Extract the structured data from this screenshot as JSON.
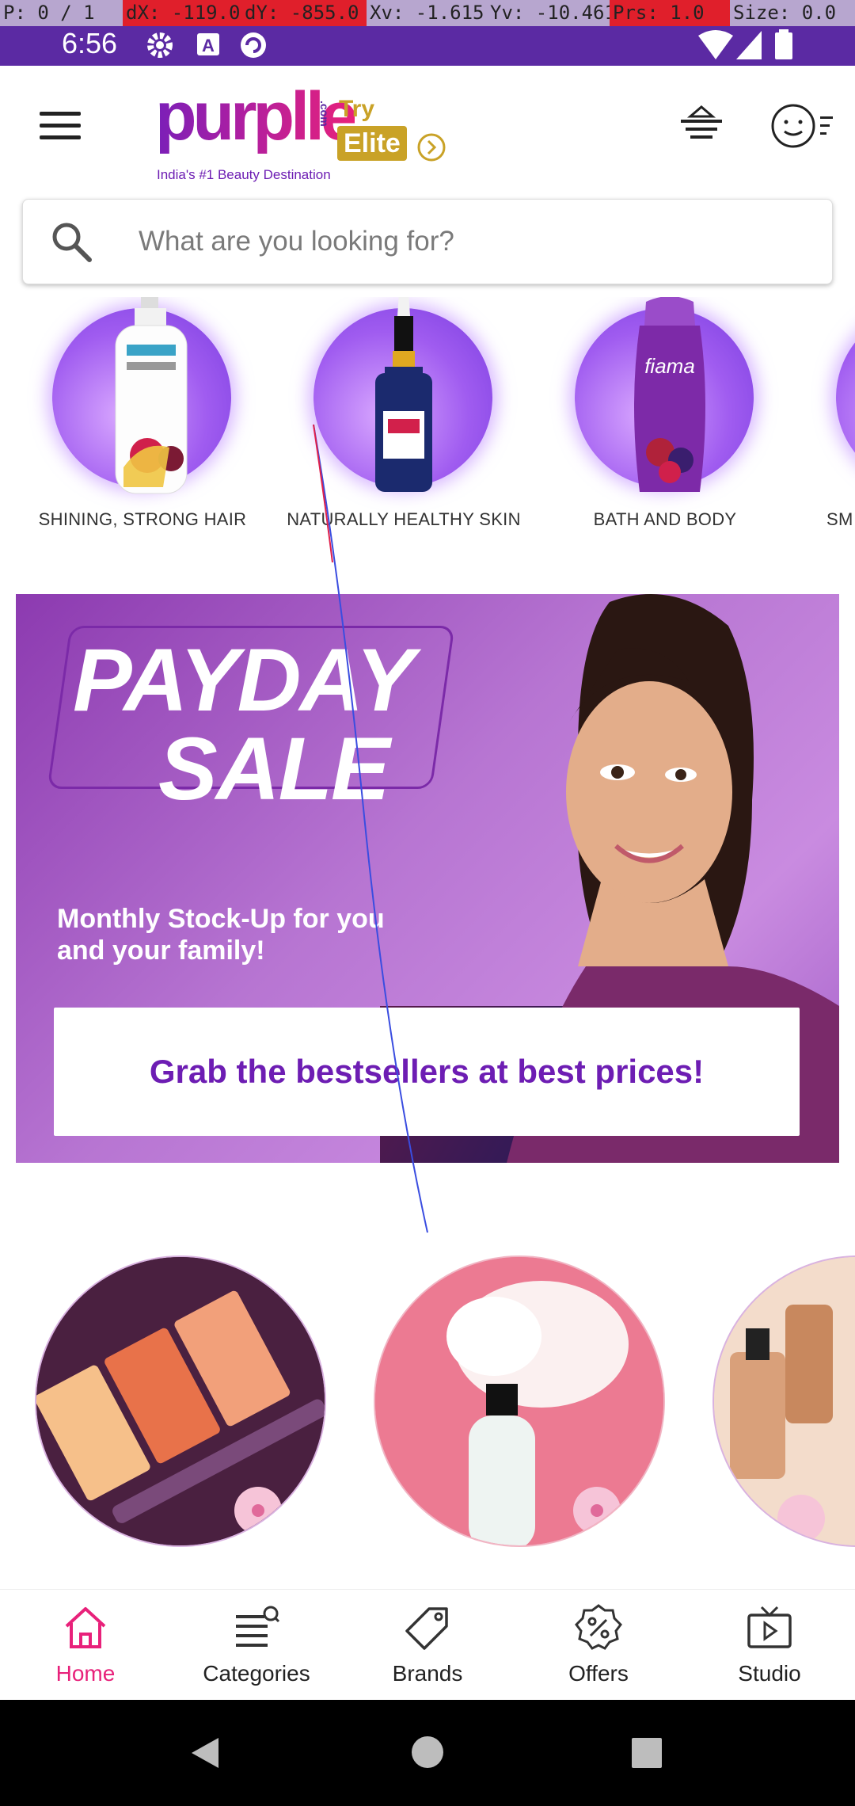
{
  "debug_overlay": {
    "pointer": "P: 0 / 1",
    "dx": "dX: -119.0",
    "dy": "dY: -855.0",
    "xv": "Xv: -1.615",
    "yv": "Yv: -10.461",
    "prs": "Prs: 1.0",
    "size": "Size: 0.0"
  },
  "status_bar": {
    "time": "6:56"
  },
  "header": {
    "logo_text": "purplle",
    "logo_suffix": ".com",
    "tagline": "India's #1 Beauty Destination",
    "try_label": "Try",
    "elite_label": "Elite"
  },
  "search": {
    "placeholder": "What are you looking for?"
  },
  "categories": [
    {
      "label": "SHINING, STRONG HAIR"
    },
    {
      "label": "NATURALLY HEALTHY SKIN"
    },
    {
      "label": "BATH AND BODY"
    },
    {
      "label": "SM"
    }
  ],
  "banner": {
    "line1": "PAYDAY",
    "line2": "SALE",
    "subtitle_line1": "Monthly Stock-Up for you",
    "subtitle_line2": "and your family!",
    "cta": "Grab the bestsellers at best prices!"
  },
  "bottom_nav": {
    "items": [
      {
        "label": "Home",
        "icon": "home-icon"
      },
      {
        "label": "Categories",
        "icon": "categories-icon"
      },
      {
        "label": "Brands",
        "icon": "tag-icon"
      },
      {
        "label": "Offers",
        "icon": "percent-badge-icon"
      },
      {
        "label": "Studio",
        "icon": "tv-icon"
      }
    ]
  },
  "colors": {
    "status_bar": "#5b2aa3",
    "brand_purple": "#6d1db3",
    "brand_pink": "#e8217a",
    "active_nav": "#e8217a",
    "elite_gold": "#c9a227"
  }
}
